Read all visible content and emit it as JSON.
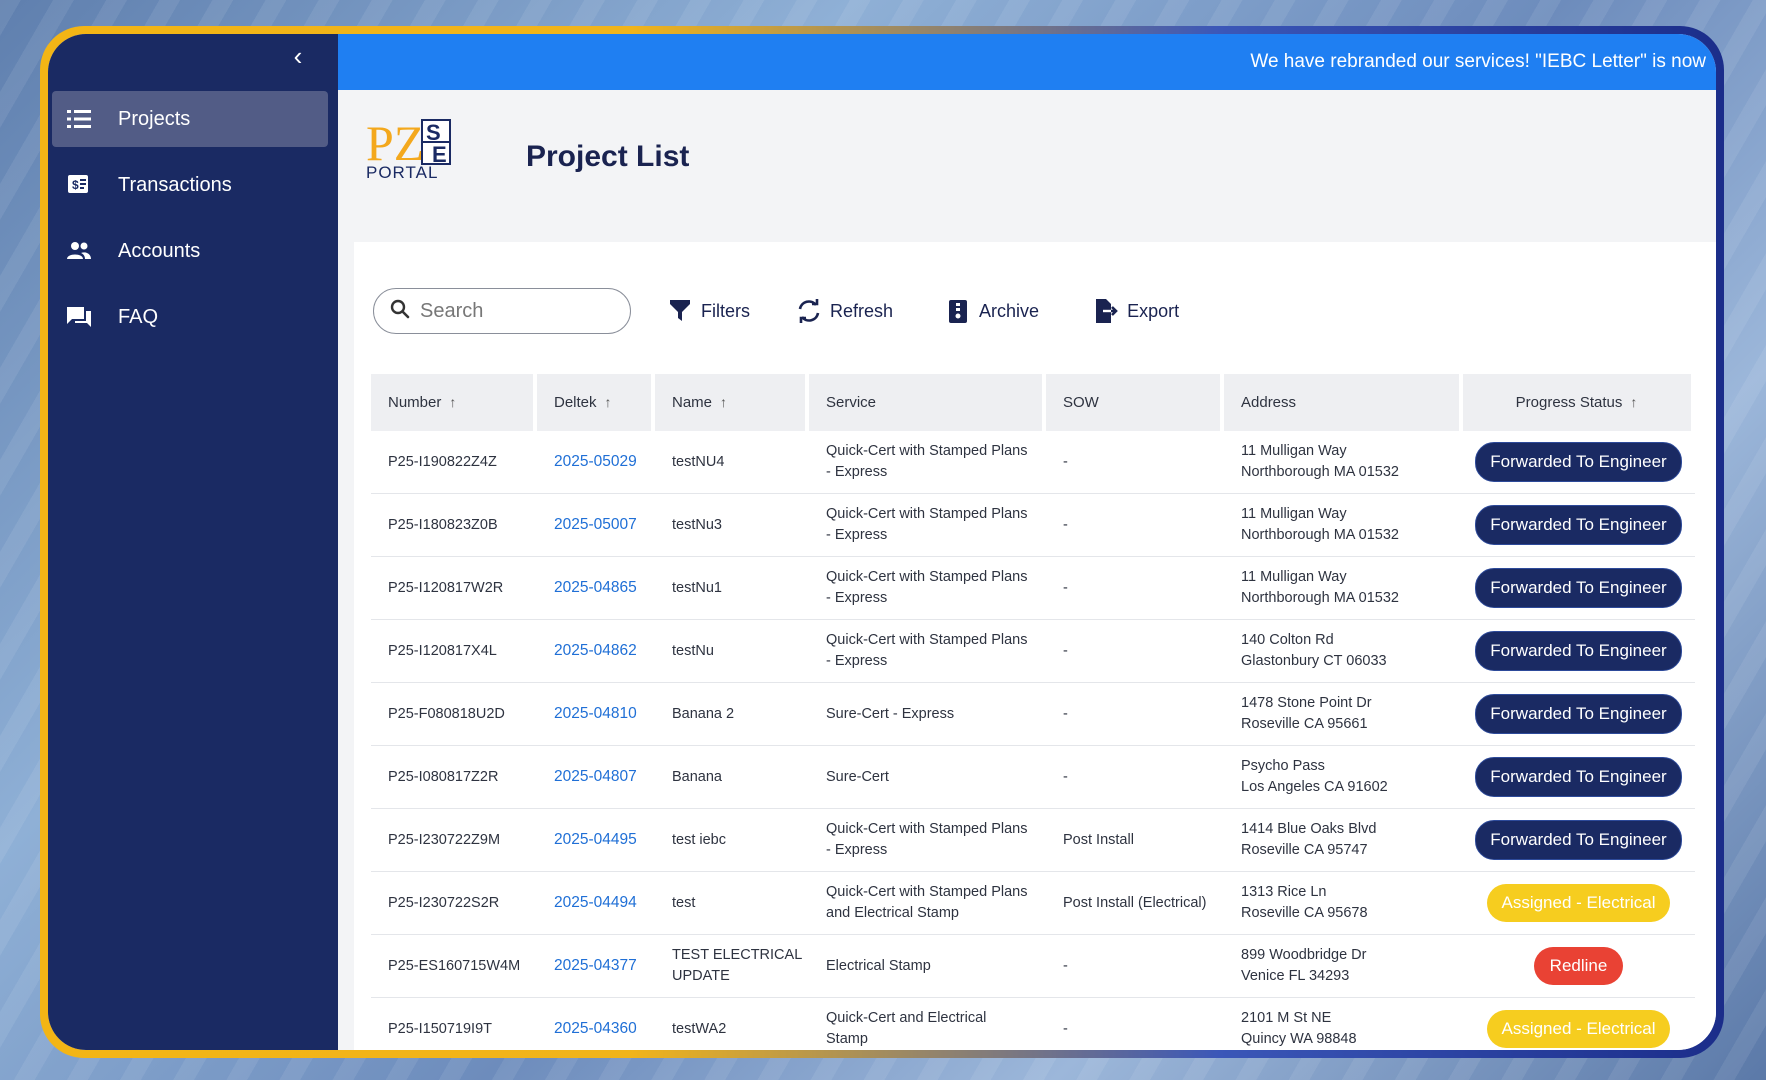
{
  "sidebar": {
    "collapse_label": "‹",
    "items": [
      {
        "label": "Projects",
        "icon": "list-icon",
        "active": true
      },
      {
        "label": "Transactions",
        "icon": "money-icon",
        "active": false
      },
      {
        "label": "Accounts",
        "icon": "users-icon",
        "active": false
      },
      {
        "label": "FAQ",
        "icon": "chat-icon",
        "active": false
      }
    ]
  },
  "banner": {
    "text": "We have rebranded our services! \"IEBC Letter\" is now"
  },
  "header": {
    "logo": {
      "letters": "PZ",
      "small_letters": "SE",
      "word": "PORTAL"
    },
    "title": "Project List"
  },
  "toolbar": {
    "search_placeholder": "Search",
    "filters_label": "Filters",
    "refresh_label": "Refresh",
    "archive_label": "Archive",
    "export_label": "Export"
  },
  "table": {
    "headers": {
      "number": "Number",
      "deltek": "Deltek",
      "name": "Name",
      "service": "Service",
      "sow": "SOW",
      "address": "Address",
      "status": "Progress Status",
      "sort_icon": "↑"
    },
    "rows": [
      {
        "number": "P25-I190822Z4Z",
        "deltek": "2025-05029",
        "name": "testNU4",
        "service1": "Quick-Cert with Stamped Plans",
        "service2": "- Express",
        "sow": "-",
        "addr1": "11 Mulligan Way",
        "addr2": "Northborough MA 01532",
        "status": "Forwarded To Engineer",
        "status_type": "fwd"
      },
      {
        "number": "P25-I180823Z0B",
        "deltek": "2025-05007",
        "name": "testNu3",
        "service1": "Quick-Cert with Stamped Plans",
        "service2": "- Express",
        "sow": "-",
        "addr1": "11 Mulligan Way",
        "addr2": "Northborough MA 01532",
        "status": "Forwarded To Engineer",
        "status_type": "fwd"
      },
      {
        "number": "P25-I120817W2R",
        "deltek": "2025-04865",
        "name": "testNu1",
        "service1": "Quick-Cert with Stamped Plans",
        "service2": "- Express",
        "sow": "-",
        "addr1": "11 Mulligan Way",
        "addr2": "Northborough MA 01532",
        "status": "Forwarded To Engineer",
        "status_type": "fwd"
      },
      {
        "number": "P25-I120817X4L",
        "deltek": "2025-04862",
        "name": "testNu",
        "service1": "Quick-Cert with Stamped Plans",
        "service2": "- Express",
        "sow": "-",
        "addr1": "140 Colton Rd",
        "addr2": "Glastonbury CT 06033",
        "status": "Forwarded To Engineer",
        "status_type": "fwd"
      },
      {
        "number": "P25-F080818U2D",
        "deltek": "2025-04810",
        "name": "Banana 2",
        "service1": "Sure-Cert - Express",
        "service2": "",
        "sow": "-",
        "addr1": "1478 Stone Point Dr",
        "addr2": "Roseville CA 95661",
        "status": "Forwarded To Engineer",
        "status_type": "fwd"
      },
      {
        "number": "P25-I080817Z2R",
        "deltek": "2025-04807",
        "name": "Banana",
        "service1": "Sure-Cert",
        "service2": "",
        "sow": "-",
        "addr1": "Psycho Pass",
        "addr2": "Los Angeles CA 91602",
        "status": "Forwarded To Engineer",
        "status_type": "fwd"
      },
      {
        "number": "P25-I230722Z9M",
        "deltek": "2025-04495",
        "name": "test iebc",
        "service1": "Quick-Cert with Stamped Plans",
        "service2": "- Express",
        "sow": "Post Install",
        "addr1": "1414 Blue Oaks Blvd",
        "addr2": "Roseville CA 95747",
        "status": "Forwarded To Engineer",
        "status_type": "fwd"
      },
      {
        "number": "P25-I230722S2R",
        "deltek": "2025-04494",
        "name": "test",
        "service1": "Quick-Cert with Stamped Plans",
        "service2": "and Electrical Stamp",
        "sow": "Post Install (Electrical)",
        "addr1": "1313 Rice Ln",
        "addr2": "Roseville CA 95678",
        "status": "Assigned - Electrical",
        "status_type": "assigned"
      },
      {
        "number": "P25-ES160715W4M",
        "deltek": "2025-04377",
        "name": "TEST ELECTRICAL",
        "name2": "UPDATE",
        "service1": "Electrical Stamp",
        "service2": "",
        "sow": "-",
        "addr1": "899 Woodbridge Dr",
        "addr2": "Venice FL 34293",
        "status": "Redline",
        "status_type": "redline"
      },
      {
        "number": "P25-I150719I9T",
        "deltek": "2025-04360",
        "name": "testWA2",
        "service1": "Quick-Cert and Electrical",
        "service2": "Stamp",
        "sow": "-",
        "addr1": "2101 M St NE",
        "addr2": "Quincy WA 98848",
        "status": "Assigned - Electrical",
        "status_type": "assigned"
      }
    ]
  },
  "colors": {
    "sidebar": "#1a2a63",
    "banner": "#1f7ff2",
    "badge_forwarded": "#1a2a63",
    "badge_assigned": "#f6cd1f",
    "badge_redline": "#e94234",
    "link": "#1f6fd6"
  }
}
